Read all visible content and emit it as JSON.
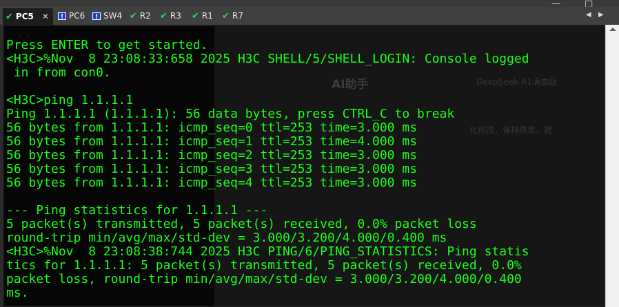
{
  "window_controls": {
    "minimize": "—",
    "maximize": "□"
  },
  "tabs": [
    {
      "label": "PC5",
      "status": "check",
      "active": true,
      "closable": true
    },
    {
      "label": "PC6",
      "status": "warning",
      "active": false
    },
    {
      "label": "SW4",
      "status": "warning",
      "active": false
    },
    {
      "label": "R2",
      "status": "check",
      "active": false
    },
    {
      "label": "R3",
      "status": "check",
      "active": false
    },
    {
      "label": "R1",
      "status": "check",
      "active": false
    },
    {
      "label": "R7",
      "status": "check",
      "active": false
    }
  ],
  "tab_close": "✕",
  "nav": {
    "left": "◀",
    "right": "▶"
  },
  "terminal": {
    "text_color": "#19ff19",
    "lines": [
      "Press ENTER to get started.",
      "<H3C>%Nov  8 23:08:33:658 2025 H3C SHELL/5/SHELL_LOGIN: Console logged",
      " in from con0.",
      "",
      "<H3C>ping 1.1.1.1",
      "Ping 1.1.1.1 (1.1.1.1): 56 data bytes, press CTRL_C to break",
      "56 bytes from 1.1.1.1: icmp_seq=0 ttl=253 time=3.000 ms",
      "56 bytes from 1.1.1.1: icmp_seq=1 ttl=253 time=4.000 ms",
      "56 bytes from 1.1.1.1: icmp_seq=2 ttl=253 time=3.000 ms",
      "56 bytes from 1.1.1.1: icmp_seq=3 ttl=253 time=3.000 ms",
      "56 bytes from 1.1.1.1: icmp_seq=4 ttl=253 time=3.000 ms",
      "",
      "--- Ping statistics for 1.1.1.1 ---",
      "5 packet(s) transmitted, 5 packet(s) received, 0.0% packet loss",
      "round-trip min/avg/max/std-dev = 3.000/3.200/4.000/0.400 ms",
      "<H3C>%Nov  8 23:08:38:744 2025 H3C PING/6/PING_STATISTICS: Ping statis",
      "tics for 1.1.1.1: 5 packet(s) transmitted, 5 packet(s) received, 0.0%",
      "packet loss, round-trip min/avg/max/std-dev = 3.000/3.200/4.000/0.400",
      "ms."
    ]
  },
  "background_overlay": {
    "ai_title": "AI助手",
    "model_hint": "DeepSeek-R1满血版",
    "snippet": "化修改，保持原意，提"
  }
}
